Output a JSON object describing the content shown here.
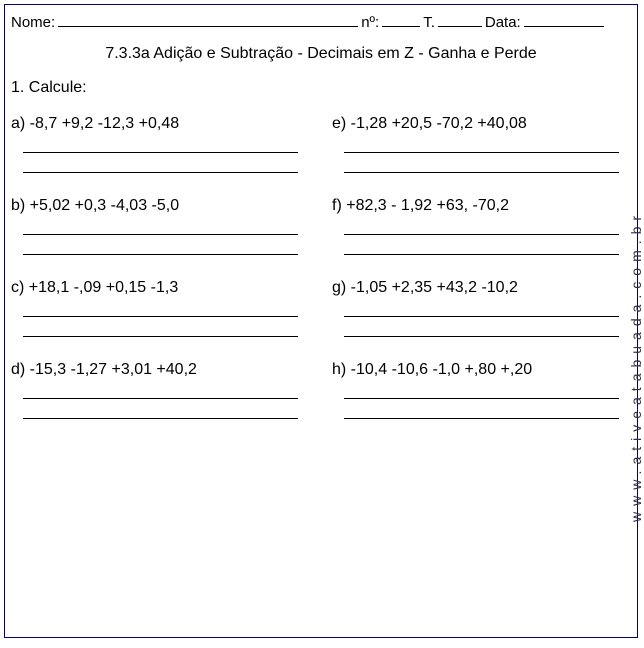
{
  "header": {
    "name_label": "Nome:",
    "number_label": "nº:",
    "class_label": "T.",
    "date_label": "Data:"
  },
  "title": "7.3.3a Adição e Subtração - Decimais em Z - Ganha e Perde",
  "instruction": "1. Calcule:",
  "problems": {
    "left": [
      {
        "label": "a) -8,7 +9,2 -12,3 +0,48"
      },
      {
        "label": "b) +5,02 +0,3 -4,03 -5,0"
      },
      {
        "label": "c) +18,1 -,09 +0,15 -1,3"
      },
      {
        "label": "d) -15,3 -1,27 +3,01 +40,2"
      }
    ],
    "right": [
      {
        "label": "e) -1,28 +20,5 -70,2 +40,08"
      },
      {
        "label": " f) +82,3 - 1,92 +63, -70,2"
      },
      {
        "label": "g) -1,05 +2,35 +43,2 -10,2"
      },
      {
        "label": "h) -10,4 -10,6 -1,0 +,80 +,20"
      }
    ]
  },
  "watermark": "www.ativeatabuada.com.br"
}
